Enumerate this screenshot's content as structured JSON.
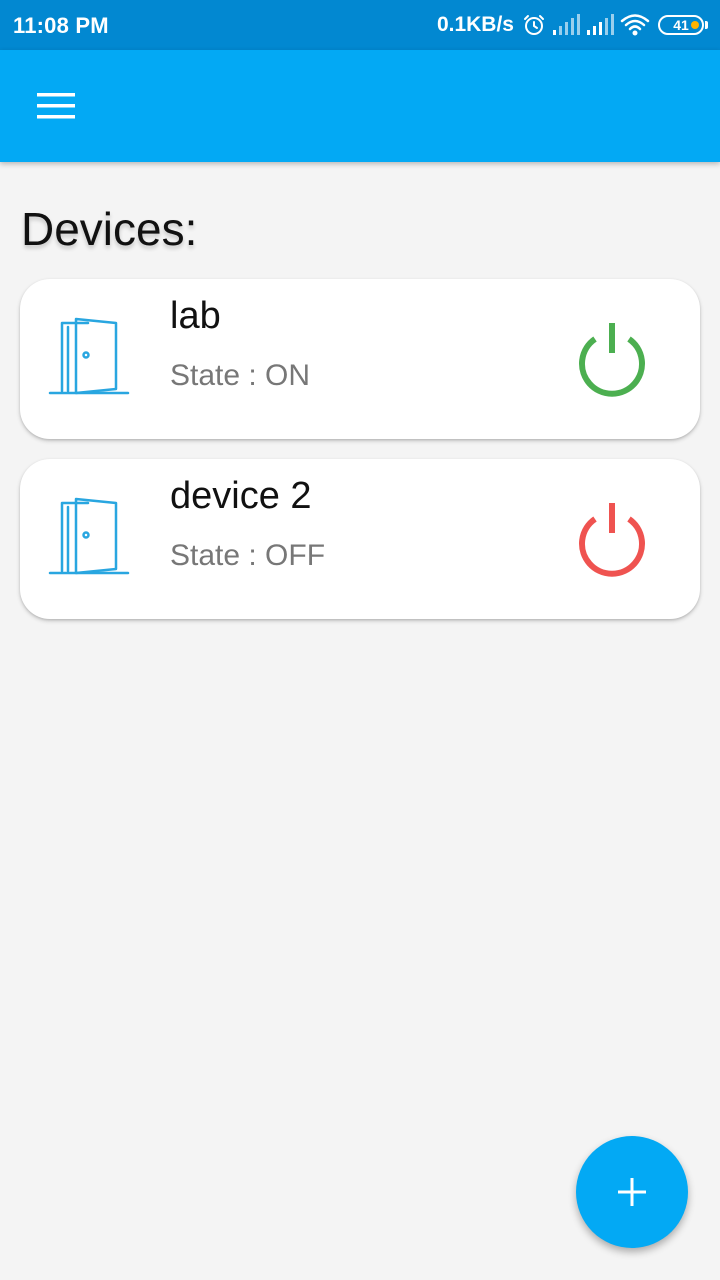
{
  "status_bar": {
    "time": "11:08 PM",
    "net_speed": "0.1KB/s",
    "battery_level": "41",
    "icons": [
      "alarm-icon",
      "signal-icon",
      "signal-icon",
      "wifi-icon",
      "battery-icon"
    ]
  },
  "app_bar": {
    "menu_icon": "hamburger-menu-icon",
    "color": "#03a9f4"
  },
  "page": {
    "title": "Devices:"
  },
  "devices": [
    {
      "name": "lab",
      "state": "State : ON",
      "icon": "door-icon",
      "power_icon": "power-icon",
      "power_color": "#4caf50"
    },
    {
      "name": "device 2",
      "state": "State : OFF",
      "icon": "door-icon",
      "power_icon": "power-icon",
      "power_color": "#ef5350"
    }
  ],
  "fab": {
    "icon": "plus-icon",
    "color": "#03a9f4"
  }
}
